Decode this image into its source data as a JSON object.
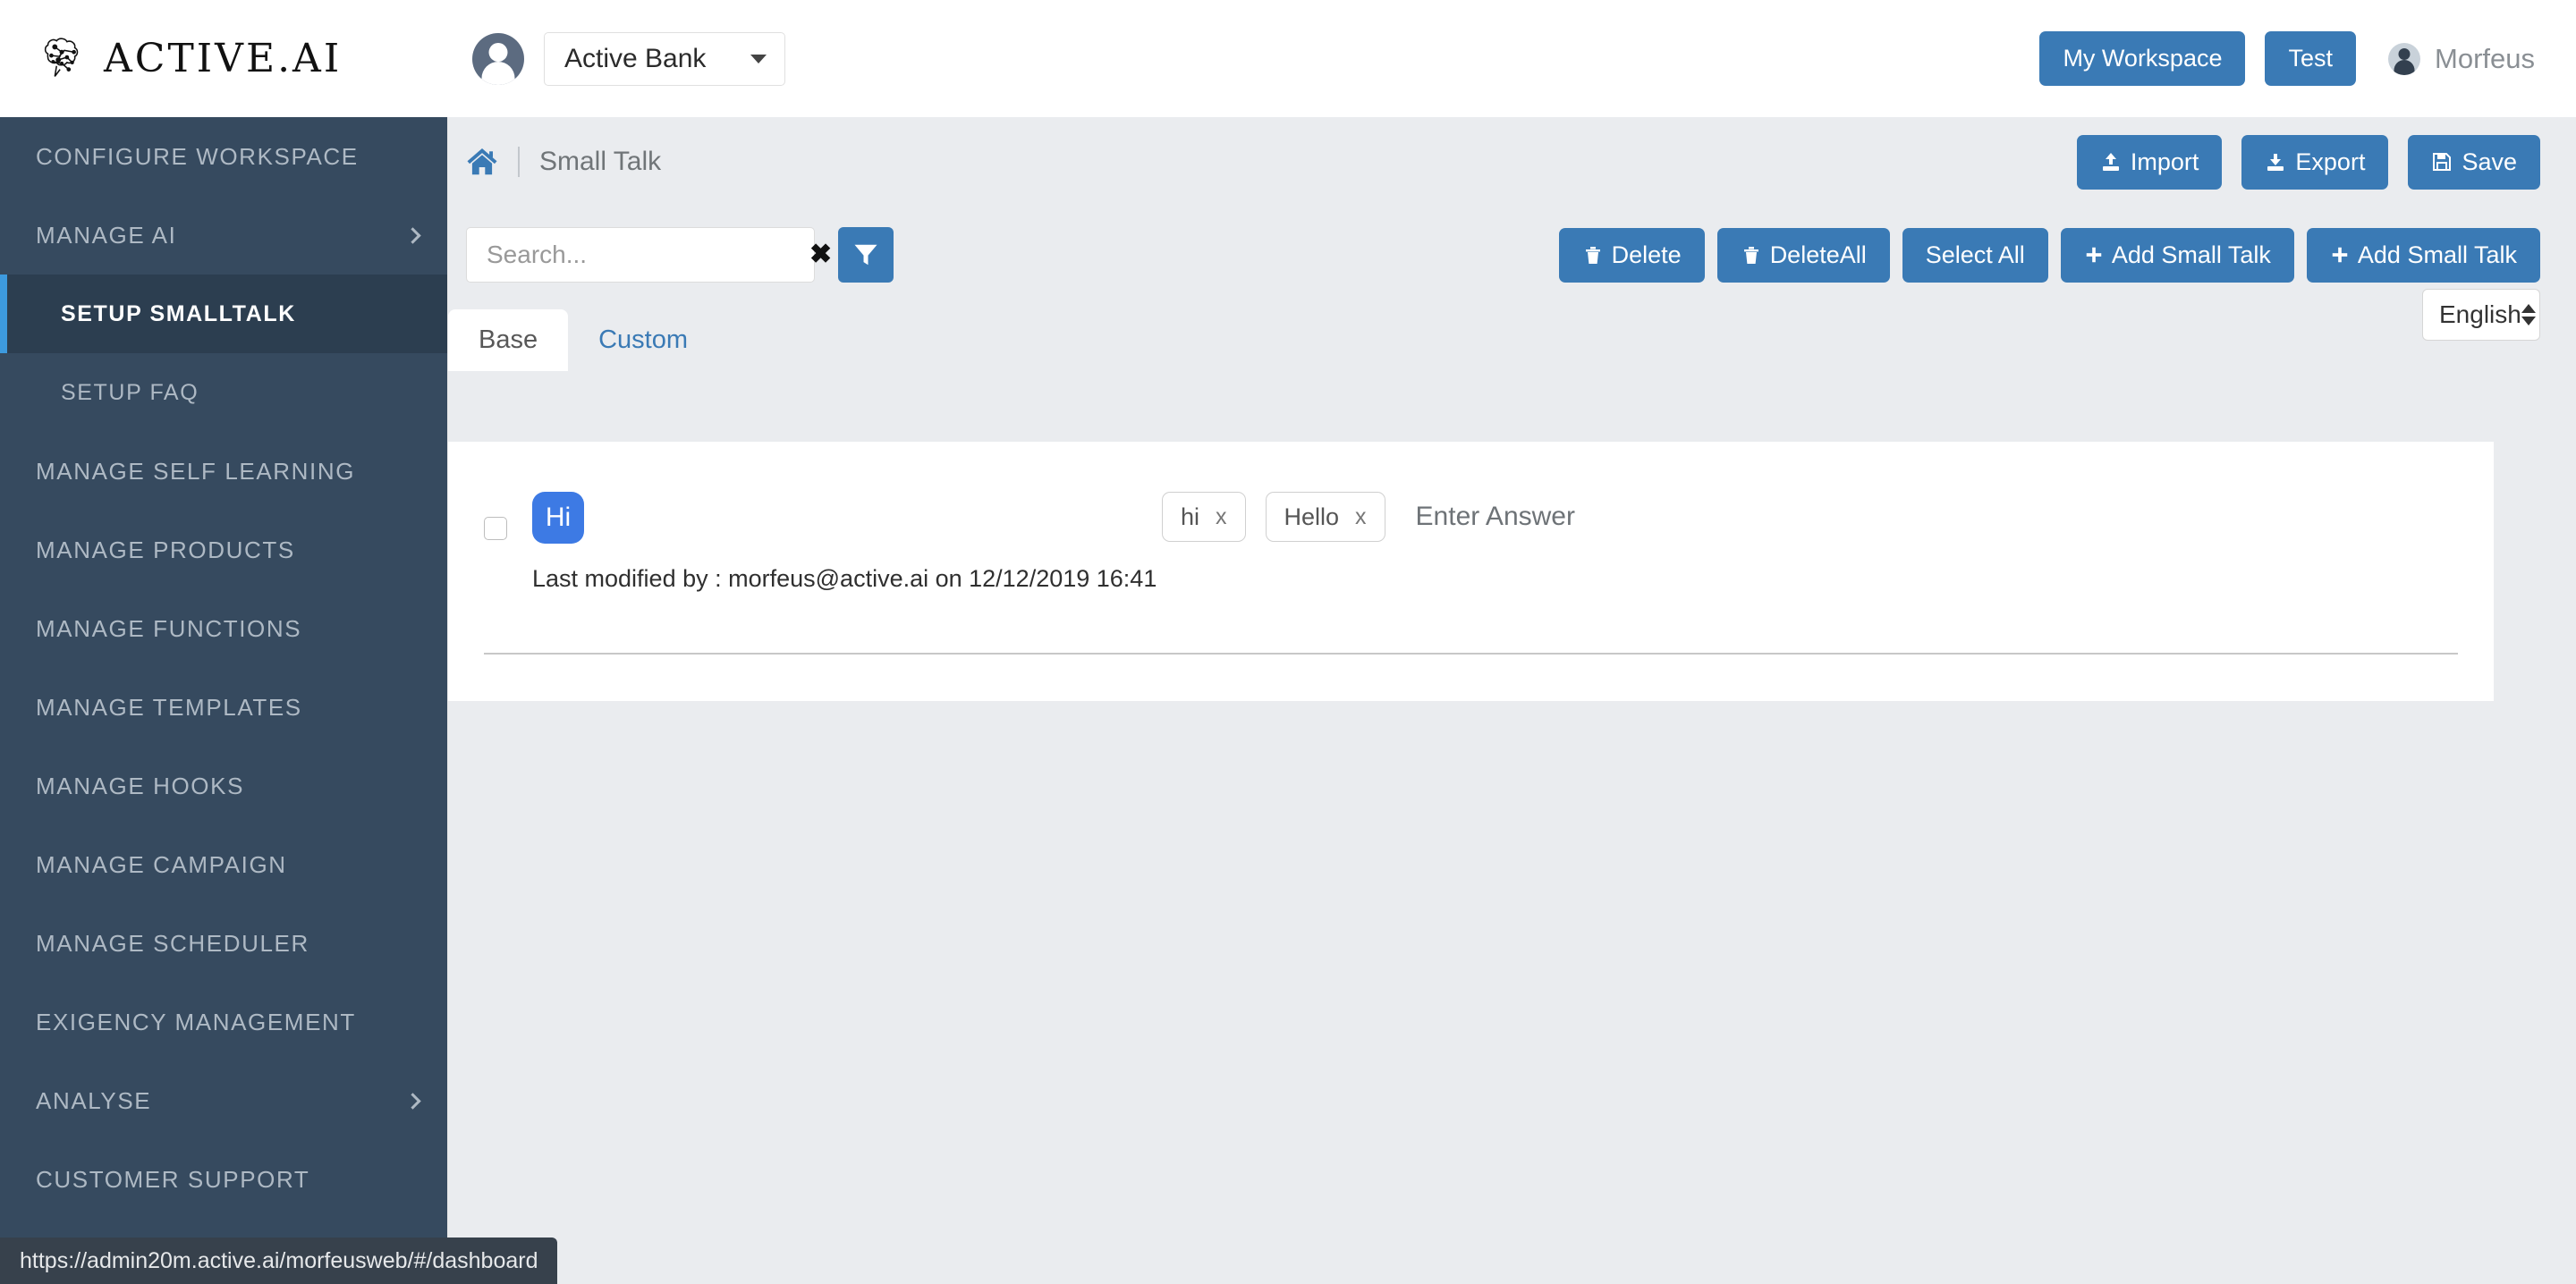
{
  "header": {
    "brand_name": "ACTIVE.AI",
    "brand_logo_icon": "brain-network-icon",
    "workspace_avatar_icon": "user-avatar-icon",
    "workspace_value": "Active Bank",
    "workspace_caret_icon": "caret-down-icon",
    "my_workspace_label": "My Workspace",
    "test_label": "Test",
    "user_avatar_icon": "user-circle-icon",
    "user_name": "Morfeus"
  },
  "sidebar": {
    "items": [
      {
        "label": "CONFIGURE WORKSPACE",
        "active": false,
        "sub": false,
        "chevron": false
      },
      {
        "label": "MANAGE AI",
        "active": false,
        "sub": false,
        "chevron": true
      },
      {
        "label": "SETUP SMALLTALK",
        "active": true,
        "sub": true,
        "chevron": false
      },
      {
        "label": "SETUP FAQ",
        "active": false,
        "sub": true,
        "chevron": false
      },
      {
        "label": "MANAGE SELF LEARNING",
        "active": false,
        "sub": false,
        "chevron": false
      },
      {
        "label": "MANAGE PRODUCTS",
        "active": false,
        "sub": false,
        "chevron": false
      },
      {
        "label": "MANAGE FUNCTIONS",
        "active": false,
        "sub": false,
        "chevron": false
      },
      {
        "label": "MANAGE TEMPLATES",
        "active": false,
        "sub": false,
        "chevron": false
      },
      {
        "label": "MANAGE HOOKS",
        "active": false,
        "sub": false,
        "chevron": false
      },
      {
        "label": "MANAGE CAMPAIGN",
        "active": false,
        "sub": false,
        "chevron": false
      },
      {
        "label": "MANAGE SCHEDULER",
        "active": false,
        "sub": false,
        "chevron": false
      },
      {
        "label": "EXIGENCY MANAGEMENT",
        "active": false,
        "sub": false,
        "chevron": false
      },
      {
        "label": "ANALYSE",
        "active": false,
        "sub": false,
        "chevron": true
      },
      {
        "label": "CUSTOMER SUPPORT",
        "active": false,
        "sub": false,
        "chevron": false
      }
    ]
  },
  "breadcrumb": {
    "home_icon": "home-icon",
    "title": "Small Talk",
    "actions": [
      {
        "label": "Import",
        "icon": "upload-icon"
      },
      {
        "label": "Export",
        "icon": "download-icon"
      },
      {
        "label": "Save",
        "icon": "floppy-disk-icon"
      }
    ]
  },
  "toolbar": {
    "search_placeholder": "Search...",
    "search_value": "",
    "search_clear_icon": "clear-x-icon",
    "filter_icon": "funnel-filter-icon",
    "buttons": [
      {
        "label": "Delete",
        "icon": "trash-icon"
      },
      {
        "label": "DeleteAll",
        "icon": "trash-icon"
      },
      {
        "label": "Select All",
        "icon": ""
      },
      {
        "label": "Add Small Talk",
        "icon": "plus-icon"
      },
      {
        "label": "Add Small Talk",
        "icon": "plus-icon"
      }
    ],
    "language_value": "English",
    "language_options": [
      "English"
    ]
  },
  "tabs": [
    {
      "label": "Base",
      "active": true
    },
    {
      "label": "Custom",
      "active": false
    }
  ],
  "content": {
    "rows": [
      {
        "checked": false,
        "badge": "Hi",
        "tags": [
          {
            "text": "hi",
            "remove": "x"
          },
          {
            "text": "Hello",
            "remove": "x"
          }
        ],
        "answer_placeholder": "Enter Answer",
        "modified": "Last modified by : morfeus@active.ai on 12/12/2019 16:41"
      }
    ]
  },
  "statusbar": {
    "url": "https://admin20m.active.ai/morfeusweb/#/dashboard"
  },
  "colors": {
    "sidebar_bg": "#364a5f",
    "sidebar_active_bg": "#2c3e50",
    "accent_blue": "#3a7ab5",
    "badge_blue": "#3d7ae4",
    "active_marker": "#3d9ade",
    "page_bg": "#eaecef"
  }
}
